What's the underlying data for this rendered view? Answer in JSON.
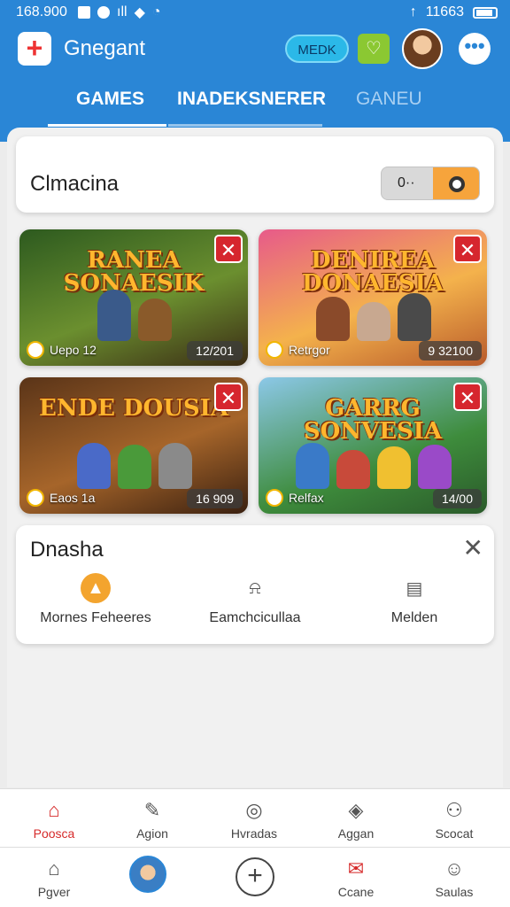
{
  "status_bar": {
    "left_time": "168.900",
    "right_time": "11663"
  },
  "app_bar": {
    "title": "Gnegant",
    "medk_label": "MEDK",
    "heart_icon": "heart-icon",
    "more_icon": "more-icon"
  },
  "tabs": [
    {
      "label": "GAMES",
      "active": true
    },
    {
      "label": "INADEKSNERER",
      "active": false
    },
    {
      "label": "GANEU",
      "active": false
    }
  ],
  "search": {
    "label": "Clmacina",
    "toggle_text": "0··"
  },
  "games": [
    {
      "title": "RANEA SONAESIK",
      "footer": "Uepo 12",
      "badge": "12/201",
      "colors": [
        "#2d5a1f",
        "#6b8f2f"
      ]
    },
    {
      "title": "DENIREA DONAESIA",
      "footer": "Retrgor",
      "badge": "9 32100",
      "colors": [
        "#e75a8a",
        "#f4b24c"
      ]
    },
    {
      "title": "ENDE DOUSIA",
      "footer": "Eaos 1a",
      "badge": "16 909",
      "colors": [
        "#5a3418",
        "#a6652a"
      ]
    },
    {
      "title": "GARRG SONVESIA",
      "footer": "Relfax",
      "badge": "14/00",
      "colors": [
        "#3e8c3c",
        "#8cc8e8"
      ]
    }
  ],
  "panel": {
    "title": "Dnasha",
    "items": [
      {
        "label": "Mornes Feheeres",
        "icon": "flame-icon"
      },
      {
        "label": "Eamchcicullaa",
        "icon": "bell-icon"
      },
      {
        "label": "Melden",
        "icon": "calendar-icon"
      }
    ]
  },
  "nav_top": [
    {
      "label": "Poosca",
      "icon": "home-icon",
      "active": true
    },
    {
      "label": "Agion",
      "icon": "edit-icon",
      "active": false
    },
    {
      "label": "Hvradas",
      "icon": "compass-icon",
      "active": false
    },
    {
      "label": "Aggan",
      "icon": "layers-icon",
      "active": false
    },
    {
      "label": "Scocat",
      "icon": "people-icon",
      "active": false
    }
  ],
  "nav_bottom": [
    {
      "label": "Pgver",
      "icon": "home-outline-icon"
    },
    {
      "label": "Ccane",
      "icon": "chat-icon"
    },
    {
      "label": "Saulas",
      "icon": "person-icon"
    }
  ]
}
